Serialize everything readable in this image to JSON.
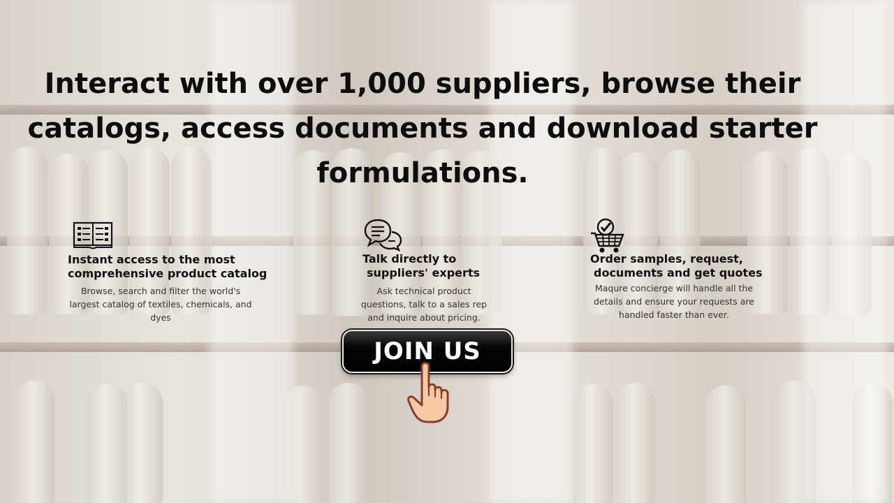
{
  "headline": "Interact with over 1,000 suppliers, browse their catalogs, access documents and download starter formulations.",
  "features": [
    {
      "icon": "catalog-book-icon",
      "title_line1": "Instant access to the most",
      "title_line2": "comprehensive product catalog",
      "desc_line1": "Browse, search and filter the world's",
      "desc_line2": "largest catalog of textiles, chemicals, and",
      "desc_line3": "dyes"
    },
    {
      "icon": "chat-bubbles-icon",
      "title_line1": "Talk directly to",
      "title_line2": "suppliers' experts",
      "desc_line1": "Ask technical product",
      "desc_line2": "questions, talk to a sales rep",
      "desc_line3": "and inquire about pricing."
    },
    {
      "icon": "shopping-cart-check-icon",
      "title_line1": "Order samples, request,",
      "title_line2": "documents and get quotes",
      "desc_line1": "Maqure concierge will handle all the",
      "desc_line2": "details and ensure your requests are",
      "desc_line3": "handled faster than ever."
    }
  ],
  "cta": {
    "label": "JOIN US",
    "icon": "pointing-hand-icon"
  },
  "colors": {
    "text": "#0d0d0d",
    "button_bg": "#000000",
    "button_text": "#ffffff",
    "hand_skin": "#f6c9a6"
  }
}
